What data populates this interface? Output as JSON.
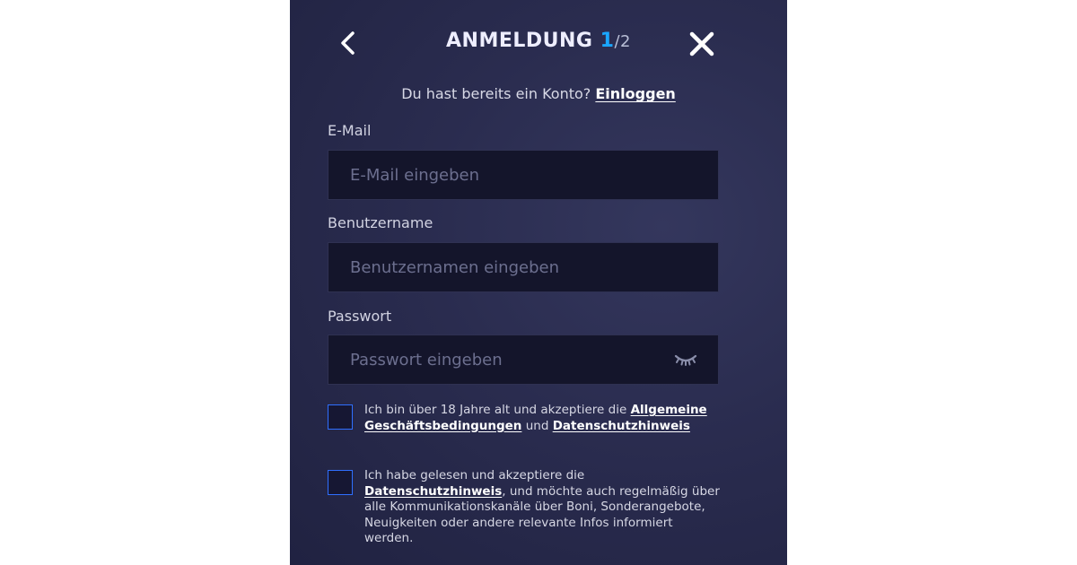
{
  "header": {
    "title": "ANMELDUNG",
    "step_current": "1",
    "step_separator": "/",
    "step_total": "2"
  },
  "login_prompt": {
    "text": "Du hast bereits ein Konto?",
    "link": "Einloggen"
  },
  "form": {
    "email": {
      "label": "E-Mail",
      "placeholder": "E-Mail eingeben",
      "value": ""
    },
    "username": {
      "label": "Benutzername",
      "placeholder": "Benutzernamen eingeben",
      "value": ""
    },
    "password": {
      "label": "Passwort",
      "placeholder": "Passwort eingeben",
      "value": "",
      "toggle_icon": "eye-closed-icon"
    }
  },
  "consents": {
    "terms": {
      "checked": false,
      "text_before": "Ich bin über 18 Jahre alt und akzeptiere die",
      "link1": "Allgemeine Geschäftsbedingungen",
      "text_middle": "und",
      "link2": "Datenschutzhinweis"
    },
    "marketing": {
      "checked": false,
      "text_before": "Ich habe gelesen und akzeptiere die",
      "link": "Datenschutzhinweis",
      "text_after": ", und möchte auch regelmäßig über alle Kommunikationskanäle über Boni, Sonderangebote, Neuigkeiten oder andere relevante Infos informiert werden."
    }
  },
  "colors": {
    "accent": "#1aa6ff",
    "checkbox_border": "#2f6fff",
    "panel_bg": "#2a2c4f",
    "field_bg": "#14152b"
  }
}
